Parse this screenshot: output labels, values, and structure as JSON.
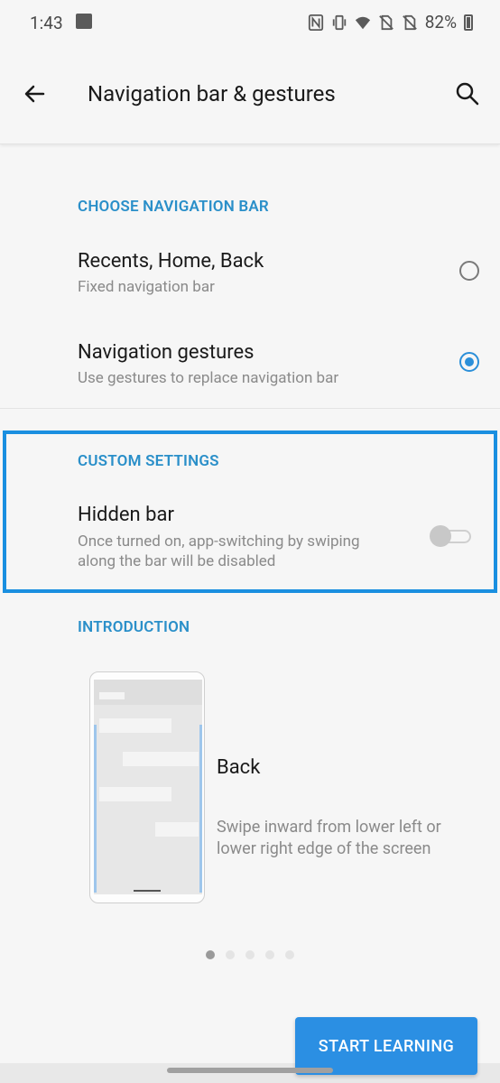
{
  "status": {
    "time": "1:43",
    "battery": "82%",
    "icons": [
      "image-icon",
      "nfc-icon",
      "vibrate-icon",
      "wifi-icon",
      "no-sim-icon",
      "no-sim-icon",
      "battery-icon"
    ]
  },
  "app_bar": {
    "title": "Navigation bar & gestures",
    "back_icon": "arrow-left-icon",
    "search_icon": "search-icon"
  },
  "choose_section": {
    "header": "CHOOSE NAVIGATION BAR",
    "options": [
      {
        "title": "Recents, Home, Back",
        "subtitle": "Fixed navigation bar",
        "selected": false
      },
      {
        "title": "Navigation gestures",
        "subtitle": "Use gestures to replace navigation bar",
        "selected": true
      }
    ]
  },
  "custom_section": {
    "header": "CUSTOM SETTINGS",
    "hidden_bar": {
      "title": "Hidden bar",
      "subtitle_line1": "Once turned on, app-switching by swiping",
      "subtitle_line2": "along the bar will be disabled",
      "enabled": false
    }
  },
  "intro_section": {
    "header": "INTRODUCTION",
    "title": "Back",
    "description": "Swipe inward from lower left or lower right edge of the screen",
    "pages": 5,
    "active_page": 1
  },
  "actions": {
    "start_learning": "START LEARNING"
  },
  "colors": {
    "accent": "#2b8fd9",
    "header_text": "#2a8fc9",
    "highlight": "#1a8fe0"
  }
}
